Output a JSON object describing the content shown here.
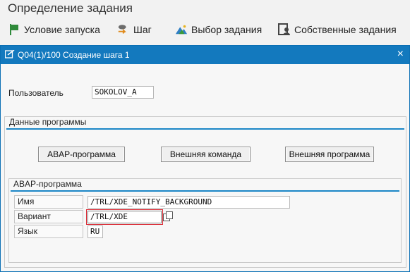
{
  "header": {
    "title": "Определение задания"
  },
  "toolbar": {
    "items": [
      {
        "label": "Условие запуска",
        "icon": "flag-icon"
      },
      {
        "label": "Шаг",
        "icon": "step-icon"
      },
      {
        "label": "Выбор задания",
        "icon": "mountain-icon"
      },
      {
        "label": "Собственные задания",
        "icon": "user-jobs-icon"
      }
    ]
  },
  "dialog": {
    "title": "Q04(1)/100 Создание шага  1",
    "close_label": "×",
    "user_label": "Пользователь",
    "user_value": "SOKOLOV_A",
    "program_group": {
      "title": "Данные программы",
      "buttons": [
        "ABAP-программа",
        "Внешняя команда",
        "Внешняя программа"
      ]
    },
    "abap_group": {
      "title": "ABAP-программа",
      "name_label": "Имя",
      "name_value": "/TRL/XDE_NOTIFY_BACKGROUND",
      "variant_label": "Вариант",
      "variant_value": "/TRL/XDE",
      "language_label": "Язык",
      "language_value": "RU"
    }
  },
  "colors": {
    "accent": "#1379be",
    "group_line": "#1a86c6",
    "flag_green": "#2f8a3a",
    "focus_red": "#d9232d"
  }
}
